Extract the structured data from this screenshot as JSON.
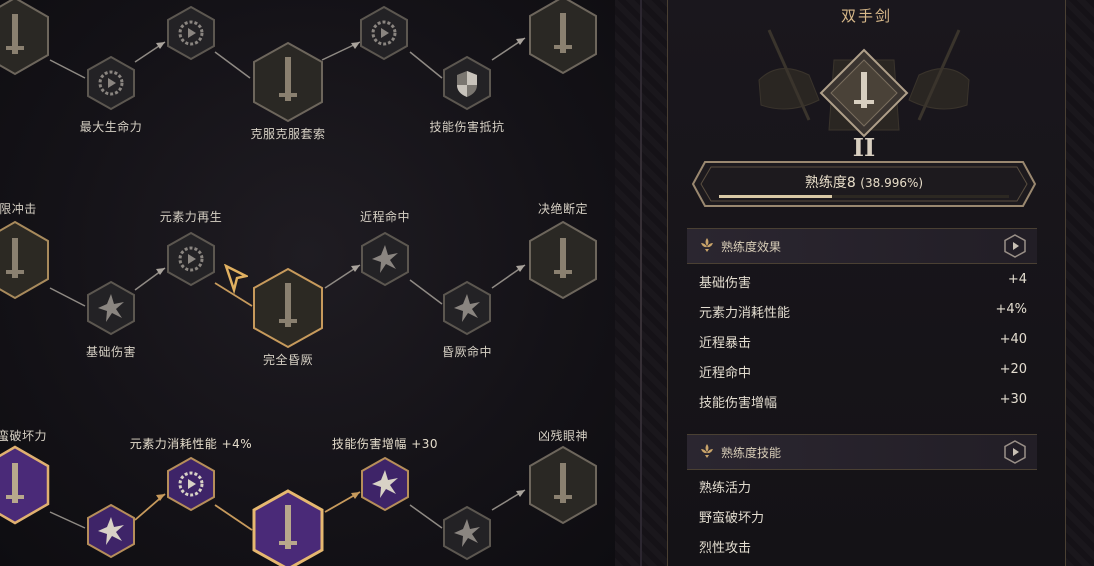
{
  "tree": {
    "labels": {
      "r1_a": "最大生命力",
      "r1_b": "克服克服套索",
      "r1_c": "技能伤害抵抗",
      "r2_start": "限冲击",
      "r2_a": "元素力再生",
      "r2_b": "基础伤害",
      "r2_c": "完全昏厥",
      "r2_d": "近程命中",
      "r2_e": "昏厥命中",
      "r2_end": "决绝断定",
      "r3_start": "蛮破坏力",
      "r3_a": "元素力消耗性能 +4%",
      "r3_b": "技能伤害增幅 +30",
      "r3_end": "凶残眼神"
    }
  },
  "panel": {
    "weapon_name": "双手剑",
    "rank_numeral": "II",
    "proficiency_label": "熟练度8",
    "proficiency_pct": "(38.996%)",
    "proficiency_progress": 0.39,
    "effects_title": "熟练度效果",
    "effects": [
      {
        "name": "基础伤害",
        "value": "+4"
      },
      {
        "name": "元素力消耗性能",
        "value": "+4%"
      },
      {
        "name": "近程暴击",
        "value": "+40"
      },
      {
        "name": "近程命中",
        "value": "+20"
      },
      {
        "name": "技能伤害增幅",
        "value": "+30"
      }
    ],
    "skills_title": "熟练度技能",
    "skills": [
      "熟练活力",
      "野蛮破坏力",
      "烈性攻击"
    ]
  },
  "colors": {
    "gold": "#c9a46a",
    "purple": "#4a2a78",
    "frame": "#8a7c68"
  }
}
